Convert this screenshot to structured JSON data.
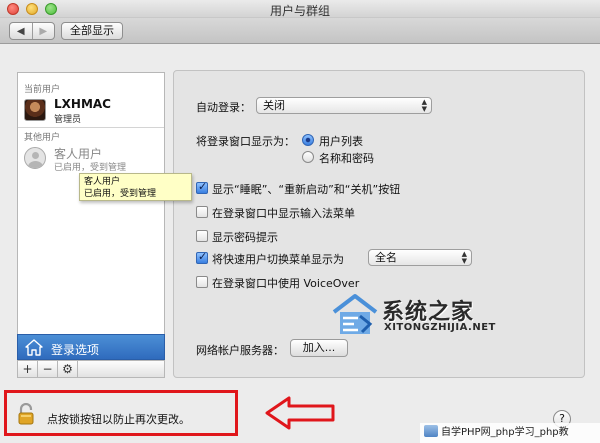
{
  "window": {
    "title": "用户与群组"
  },
  "toolbar": {
    "back": "◀",
    "forward": "▶",
    "show_all": "全部显示"
  },
  "sidebar": {
    "current_header": "当前用户",
    "current_user": {
      "name": "LXHMAC",
      "role": "管理员"
    },
    "other_header": "其他用户",
    "guest_user": {
      "name": "客人用户",
      "status": "已启用，受到管理"
    },
    "tooltip": {
      "line1": "客人用户",
      "line2": "已启用，受到管理"
    },
    "login_options": "登录选项",
    "tools": {
      "add": "+",
      "remove": "−",
      "settings": "⚙"
    }
  },
  "login": {
    "auto_login_label": "自动登录：",
    "auto_login_value": "关闭",
    "display_label": "将登录窗口显示为：",
    "radio_list": "用户列表",
    "radio_name_pw": "名称和密码",
    "checks": [
      {
        "label": "显示“睡眠”、“重新启动”和“关机”按钮",
        "checked": true
      },
      {
        "label": "在登录窗口中显示输入法菜单",
        "checked": false
      },
      {
        "label": "显示密码提示",
        "checked": false
      },
      {
        "label": "将快速用户切换菜单显示为",
        "checked": true
      },
      {
        "label": "在登录窗口中使用 VoiceOver",
        "checked": false
      }
    ],
    "fast_switch_value": "全名",
    "network_label": "网络帐户服务器：",
    "join_button": "加入..."
  },
  "watermark": {
    "title": "系统之家",
    "subtitle": "XITONGZHIJIA.NET",
    "site": "自学PHP网_php学习_php教"
  },
  "bottom": {
    "lock_text": "点按锁按钮以防止再次更改。",
    "help": "?"
  },
  "colors": {
    "selection": "#3a7ccc",
    "highlight_box": "#e0161b",
    "tooltip_bg": "#ffffc6"
  }
}
